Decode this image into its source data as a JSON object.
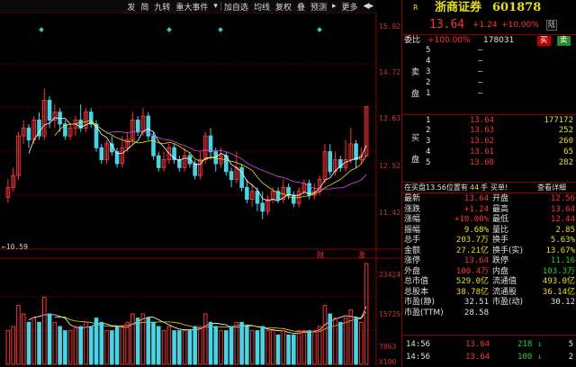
{
  "toolbar": {
    "items": [
      "发",
      "简",
      "九转",
      "重大事件",
      "▾",
      "加自选",
      "均线",
      "复权",
      "叠",
      "预测",
      "▸",
      "更多",
      "◀▸"
    ]
  },
  "chart": {
    "price_axis": [
      "15.82",
      "14.72",
      "13.63",
      "12.52",
      "11.42"
    ],
    "low_label": "10.59",
    "vol_axis": [
      "23424",
      "15725",
      "7863"
    ],
    "vol_unit": "X100",
    "marker_cai": "财",
    "marker_zhang": "涨",
    "colors": {
      "up": "#ff3030",
      "down": "#40d8e8",
      "ma5": "#ffffff",
      "ma10": "#e8e000",
      "ma20": "#e040e0"
    }
  },
  "chart_data": {
    "type": "candlestick",
    "ylim": [
      10.2,
      15.9
    ],
    "candles": [
      {
        "o": 11.35,
        "c": 11.6,
        "h": 11.8,
        "l": 11.2
      },
      {
        "o": 11.6,
        "c": 11.9,
        "h": 12.1,
        "l": 11.5
      },
      {
        "o": 11.9,
        "c": 12.9,
        "h": 13.0,
        "l": 11.8
      },
      {
        "o": 12.9,
        "c": 13.1,
        "h": 13.3,
        "l": 12.7
      },
      {
        "o": 13.1,
        "c": 12.8,
        "h": 13.2,
        "l": 12.6
      },
      {
        "o": 12.8,
        "c": 13.3,
        "h": 13.4,
        "l": 12.7
      },
      {
        "o": 13.3,
        "c": 12.9,
        "h": 13.5,
        "l": 12.8
      },
      {
        "o": 12.9,
        "c": 13.8,
        "h": 14.1,
        "l": 12.8
      },
      {
        "o": 13.8,
        "c": 13.3,
        "h": 13.9,
        "l": 13.1
      },
      {
        "o": 13.3,
        "c": 13.5,
        "h": 13.7,
        "l": 13.1
      },
      {
        "o": 13.5,
        "c": 13.2,
        "h": 13.6,
        "l": 13.0
      },
      {
        "o": 13.2,
        "c": 12.9,
        "h": 13.3,
        "l": 12.8
      },
      {
        "o": 12.9,
        "c": 13.1,
        "h": 13.2,
        "l": 12.8
      },
      {
        "o": 13.1,
        "c": 13.3,
        "h": 13.4,
        "l": 12.9
      },
      {
        "o": 13.3,
        "c": 13.1,
        "h": 13.7,
        "l": 13.0
      },
      {
        "o": 13.1,
        "c": 13.5,
        "h": 13.6,
        "l": 13.0
      },
      {
        "o": 13.5,
        "c": 13.2,
        "h": 13.6,
        "l": 13.1
      },
      {
        "o": 13.2,
        "c": 12.6,
        "h": 13.3,
        "l": 12.5
      },
      {
        "o": 12.6,
        "c": 12.3,
        "h": 12.7,
        "l": 12.2
      },
      {
        "o": 12.3,
        "c": 12.7,
        "h": 12.8,
        "l": 12.2
      },
      {
        "o": 12.7,
        "c": 12.5,
        "h": 12.9,
        "l": 12.4
      },
      {
        "o": 12.5,
        "c": 12.2,
        "h": 12.6,
        "l": 12.1
      },
      {
        "o": 12.2,
        "c": 12.6,
        "h": 12.9,
        "l": 12.1
      },
      {
        "o": 12.6,
        "c": 12.8,
        "h": 13.0,
        "l": 12.5
      },
      {
        "o": 12.8,
        "c": 13.3,
        "h": 13.5,
        "l": 12.7
      },
      {
        "o": 13.3,
        "c": 13.0,
        "h": 13.4,
        "l": 12.9
      },
      {
        "o": 13.0,
        "c": 13.4,
        "h": 13.6,
        "l": 12.9
      },
      {
        "o": 13.4,
        "c": 12.9,
        "h": 13.5,
        "l": 12.8
      },
      {
        "o": 12.9,
        "c": 12.4,
        "h": 13.0,
        "l": 12.3
      },
      {
        "o": 12.4,
        "c": 12.1,
        "h": 12.5,
        "l": 12.0
      },
      {
        "o": 12.1,
        "c": 12.3,
        "h": 12.5,
        "l": 12.0
      },
      {
        "o": 12.3,
        "c": 12.6,
        "h": 12.7,
        "l": 12.2
      },
      {
        "o": 12.6,
        "c": 12.3,
        "h": 12.7,
        "l": 12.2
      },
      {
        "o": 12.3,
        "c": 12.1,
        "h": 12.4,
        "l": 12.0
      },
      {
        "o": 12.1,
        "c": 12.4,
        "h": 12.6,
        "l": 12.0
      },
      {
        "o": 12.4,
        "c": 12.2,
        "h": 12.5,
        "l": 12.1
      },
      {
        "o": 12.2,
        "c": 11.9,
        "h": 12.3,
        "l": 11.8
      },
      {
        "o": 11.9,
        "c": 12.3,
        "h": 12.5,
        "l": 11.8
      },
      {
        "o": 12.3,
        "c": 12.9,
        "h": 13.0,
        "l": 12.2
      },
      {
        "o": 12.9,
        "c": 12.5,
        "h": 13.1,
        "l": 12.3
      },
      {
        "o": 12.5,
        "c": 12.2,
        "h": 12.6,
        "l": 12.0
      },
      {
        "o": 12.2,
        "c": 12.4,
        "h": 12.6,
        "l": 12.1
      },
      {
        "o": 12.4,
        "c": 12.0,
        "h": 12.5,
        "l": 11.9
      },
      {
        "o": 12.0,
        "c": 11.8,
        "h": 12.1,
        "l": 11.6
      },
      {
        "o": 11.8,
        "c": 12.1,
        "h": 12.5,
        "l": 11.7
      },
      {
        "o": 12.1,
        "c": 11.6,
        "h": 12.2,
        "l": 11.5
      },
      {
        "o": 11.6,
        "c": 11.3,
        "h": 11.8,
        "l": 11.2
      },
      {
        "o": 11.3,
        "c": 11.5,
        "h": 11.7,
        "l": 11.1
      },
      {
        "o": 11.5,
        "c": 11.2,
        "h": 11.6,
        "l": 11.0
      },
      {
        "o": 11.2,
        "c": 11.0,
        "h": 11.5,
        "l": 10.8
      },
      {
        "o": 11.0,
        "c": 11.3,
        "h": 11.4,
        "l": 10.9
      },
      {
        "o": 11.3,
        "c": 11.5,
        "h": 11.6,
        "l": 11.2
      },
      {
        "o": 11.5,
        "c": 11.3,
        "h": 11.6,
        "l": 11.2
      },
      {
        "o": 11.3,
        "c": 11.6,
        "h": 11.8,
        "l": 11.2
      },
      {
        "o": 11.6,
        "c": 11.4,
        "h": 11.7,
        "l": 11.3
      },
      {
        "o": 11.4,
        "c": 11.2,
        "h": 11.5,
        "l": 11.1
      },
      {
        "o": 11.2,
        "c": 11.5,
        "h": 11.6,
        "l": 11.1
      },
      {
        "o": 11.5,
        "c": 11.7,
        "h": 11.8,
        "l": 11.4
      },
      {
        "o": 11.7,
        "c": 11.4,
        "h": 11.8,
        "l": 11.3
      },
      {
        "o": 11.4,
        "c": 11.5,
        "h": 11.7,
        "l": 11.3
      },
      {
        "o": 11.5,
        "c": 11.8,
        "h": 11.9,
        "l": 11.4
      },
      {
        "o": 11.8,
        "c": 12.5,
        "h": 12.7,
        "l": 11.7
      },
      {
        "o": 12.5,
        "c": 12.0,
        "h": 12.7,
        "l": 11.9
      },
      {
        "o": 12.0,
        "c": 12.3,
        "h": 12.5,
        "l": 11.9
      },
      {
        "o": 12.3,
        "c": 12.1,
        "h": 12.4,
        "l": 12.0
      },
      {
        "o": 12.1,
        "c": 12.3,
        "h": 12.8,
        "l": 12.0
      },
      {
        "o": 12.3,
        "c": 12.7,
        "h": 13.1,
        "l": 12.2
      },
      {
        "o": 12.7,
        "c": 12.3,
        "h": 12.8,
        "l": 12.1
      },
      {
        "o": 12.3,
        "c": 12.4,
        "h": 12.6,
        "l": 12.2
      },
      {
        "o": 12.4,
        "c": 13.64,
        "h": 13.64,
        "l": 12.4
      }
    ],
    "volumes": [
      8,
      9,
      14,
      12,
      10,
      11,
      10,
      16,
      12,
      10,
      9,
      8,
      8,
      9,
      9,
      10,
      9,
      11,
      10,
      8,
      8,
      9,
      9,
      10,
      12,
      11,
      12,
      11,
      10,
      9,
      8,
      9,
      8,
      8,
      8,
      8,
      9,
      9,
      12,
      10,
      9,
      8,
      8,
      9,
      10,
      10,
      9,
      8,
      8,
      9,
      8,
      8,
      7,
      8,
      7,
      7,
      8,
      8,
      8,
      8,
      9,
      14,
      12,
      11,
      10,
      11,
      13,
      11,
      10,
      24
    ]
  },
  "quote": {
    "r_label": "R",
    "name": "浙商证券",
    "code": "601878",
    "price": "13.64",
    "change": "+1.24",
    "change_pct": "+10.00%",
    "tag": "陆",
    "webi_label": "委比",
    "webi": "+100.00%",
    "webi_vol": "178031",
    "buy_btn": "买",
    "sell_btn": "卖"
  },
  "sell_orders": [
    {
      "level": "5",
      "price": "—",
      "vol": ""
    },
    {
      "level": "4",
      "price": "—",
      "vol": ""
    },
    {
      "level": "3",
      "price": "—",
      "vol": ""
    },
    {
      "level": "2",
      "price": "—",
      "vol": ""
    },
    {
      "level": "1",
      "price": "—",
      "vol": ""
    }
  ],
  "sell_side_labels": [
    "卖",
    "盘"
  ],
  "buy_side_labels": [
    "买",
    "盘"
  ],
  "buy_orders": [
    {
      "level": "1",
      "price": "13.64",
      "vol": "177172"
    },
    {
      "level": "2",
      "price": "13.63",
      "vol": "252"
    },
    {
      "level": "3",
      "price": "13.62",
      "vol": "260"
    },
    {
      "level": "4",
      "price": "13.61",
      "vol": "65"
    },
    {
      "level": "5",
      "price": "13.60",
      "vol": "282"
    }
  ],
  "notice": {
    "text1": "在买盘13.56位置有",
    "num": "44",
    "text2": "手",
    "action": "买单!",
    "link": "查看详细"
  },
  "stats": [
    {
      "l1": "最新",
      "v1": "13.64",
      "c1": "red",
      "l2": "开盘",
      "v2": "12.56",
      "c2": "red"
    },
    {
      "l1": "涨跌",
      "v1": "+1.24",
      "c1": "red",
      "l2": "最高",
      "v2": "13.64",
      "c2": "red"
    },
    {
      "l1": "涨幅",
      "v1": "+10.00%",
      "c1": "red",
      "l2": "最低",
      "v2": "12.44",
      "c2": "red"
    },
    {
      "l1": "振幅",
      "v1": "9.68%",
      "c1": "yel",
      "l2": "量比",
      "v2": "2.85",
      "c2": "yel"
    },
    {
      "l1": "总手",
      "v1": "203.7万",
      "c1": "yel",
      "l2": "换手",
      "v2": "5.63%",
      "c2": "yel"
    },
    {
      "l1": "金额",
      "v1": "27.21亿",
      "c1": "yel",
      "l2": "换手(实)",
      "v2": "13.67%",
      "c2": "yel"
    },
    {
      "l1": "涨停",
      "v1": "13.64",
      "c1": "red",
      "l2": "跌停",
      "v2": "11.16",
      "c2": "grn"
    },
    {
      "l1": "外盘",
      "v1": "100.4万",
      "c1": "red",
      "l2": "内盘",
      "v2": "103.3万",
      "c2": "grn"
    },
    {
      "l1": "总市值",
      "v1": "529.0亿",
      "c1": "yel",
      "l2": "流通值",
      "v2": "493.0亿",
      "c2": "yel"
    },
    {
      "l1": "总股本",
      "v1": "38.78亿",
      "c1": "yel",
      "l2": "流通股",
      "v2": "36.14亿",
      "c2": "yel"
    },
    {
      "l1": "市盈(静)",
      "v1": "32.51",
      "c1": "wht",
      "l2": "市盈(动)",
      "v2": "30.12",
      "c2": "wht"
    },
    {
      "l1": "市盈(TTM)",
      "v1": "28.58",
      "c1": "wht",
      "l2": "",
      "v2": "",
      "c2": "wht"
    }
  ],
  "ticks": [
    {
      "time": "14:56",
      "price": "13.64",
      "vol": "218",
      "arrow": "↓",
      "num": "5"
    },
    {
      "time": "14:56",
      "price": "13.64",
      "vol": "100",
      "arrow": "↓",
      "num": "2"
    }
  ]
}
